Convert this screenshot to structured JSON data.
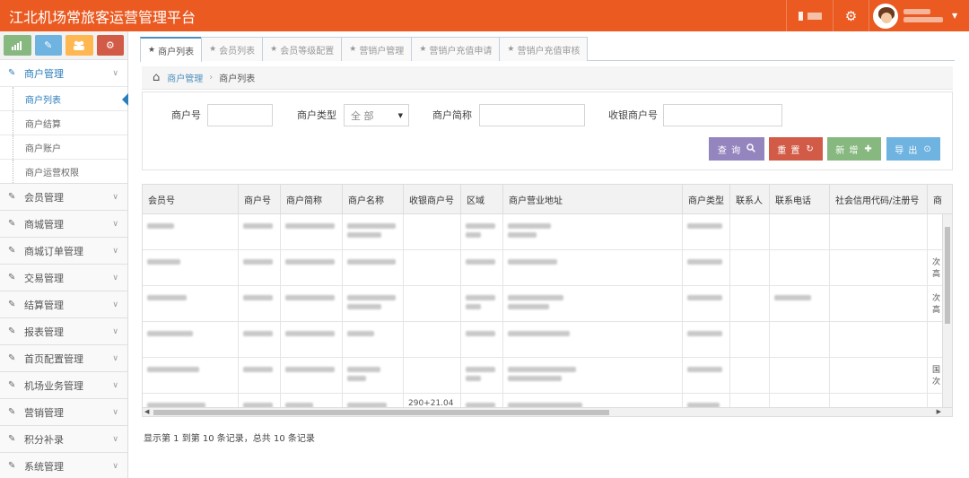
{
  "header": {
    "title": "江北机场常旅客运营管理平台",
    "colors": {
      "brand": "#ea5a21"
    },
    "icons": [
      "bar-chart-icon",
      "gear-icon",
      "avatar",
      "caret-down-icon"
    ]
  },
  "sidebar": {
    "shortcuts": [
      {
        "icon": "signal-icon",
        "color": "#87b87f"
      },
      {
        "icon": "pencil-icon",
        "color": "#6fb3e0"
      },
      {
        "icon": "users-icon",
        "color": "#ffb752"
      },
      {
        "icon": "cogs-icon",
        "color": "#d15b47"
      }
    ],
    "open_menu": {
      "label": "商户管理",
      "icon": "edit-icon"
    },
    "sub_items": [
      "商户列表",
      "商户结算",
      "商户账户",
      "商户运营权限"
    ],
    "active_sub": "商户列表",
    "menus": [
      "会员管理",
      "商城管理",
      "商城订单管理",
      "交易管理",
      "结算管理",
      "报表管理",
      "首页配置管理",
      "机场业务管理",
      "营销管理",
      "积分补录",
      "系统管理"
    ]
  },
  "tabs": [
    "商户列表",
    "会员列表",
    "会员等级配置",
    "营销户管理",
    "营销户充值申请",
    "营销户充值审核"
  ],
  "breadcrumb": {
    "parent": "商户管理",
    "current": "商户列表"
  },
  "search": {
    "fields": {
      "merchant_no": "商户号",
      "merchant_type": "商户类型",
      "merchant_type_value": "全 部",
      "merchant_short": "商户简称",
      "cashier_no": "收银商户号"
    },
    "buttons": {
      "query": "查 询",
      "reset": "重 置",
      "add": "新 增",
      "export": "导 出"
    }
  },
  "table": {
    "columns": [
      "会员号",
      "商户号",
      "商户简称",
      "商户名称",
      "收银商户号",
      "区域",
      "商户营业地址",
      "商户类型",
      "联系人",
      "联系电话",
      "社会信用代码/注册号",
      "商"
    ],
    "visible_cell_text": {
      "row6_cashier": "290+21.04",
      "row2_extra": "次\n高",
      "row3_extra": "次\n高",
      "row5_extra": "国\n次"
    }
  },
  "pager": {
    "info": "显示第 1 到第 10 条记录，总共 10 条记录"
  }
}
